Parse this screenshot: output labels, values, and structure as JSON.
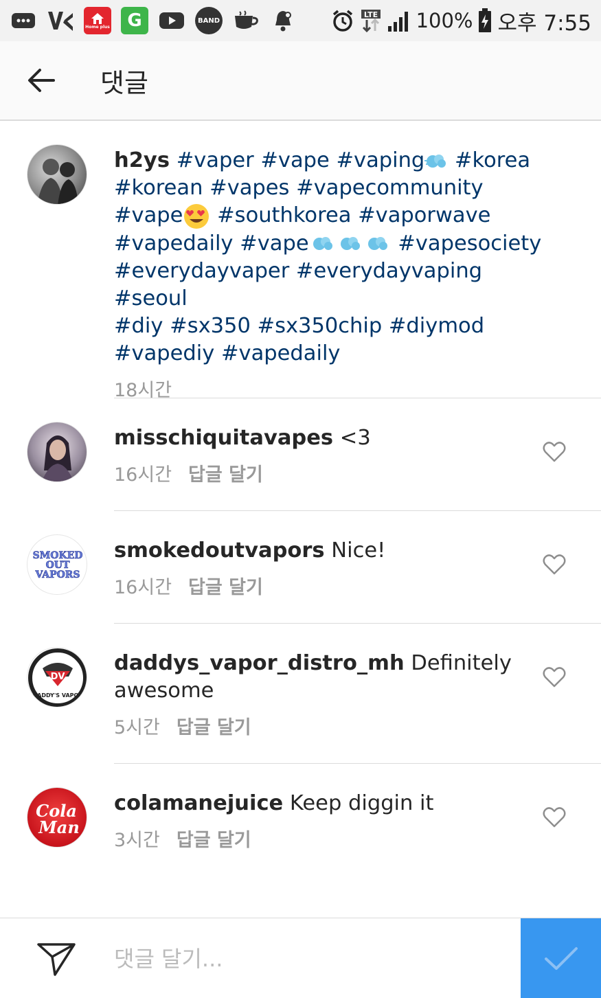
{
  "status_bar": {
    "battery_percent": "100%",
    "time": "오후 7:55",
    "network": "LTE",
    "icons": [
      "message-icon",
      "vs-icon",
      "homeplus-icon",
      "gmarket-icon",
      "youtube-icon",
      "band-icon",
      "cafe-icon",
      "notification-icon",
      "alarm-icon",
      "lte-icon",
      "signal-icon",
      "battery-charging-icon"
    ],
    "homeplus_label": "Home plus",
    "gmarket_label": "G",
    "band_label": "BAND"
  },
  "app_bar": {
    "title": "댓글"
  },
  "caption": {
    "username": "h2ys",
    "tags_line1": "#vaper #vape #vaping",
    "tags_line1b": " #korea",
    "tags_line2": "#korean #vapes #vapecommunity",
    "tags_line3a": "#vape",
    "tags_line3b": " #southkorea #vaporwave",
    "tags_line4a": "#vapedaily #vape",
    "tags_line4b": " #vapesociety",
    "tags_line5": "#everydayvaper #everydayvaping #seoul",
    "tags_line6": "#diy #sx350 #sx350chip #diymod",
    "tags_line7": "#vapediy #vapedaily",
    "time": "18시간"
  },
  "comments": [
    {
      "username": "misschiquitavapes",
      "text": " <3",
      "time": "16시간",
      "reply": "답글 달기"
    },
    {
      "username": "smokedoutvapors",
      "text": " Nice!",
      "time": "16시간",
      "reply": "답글 달기"
    },
    {
      "username": "daddys_vapor_distro_mh",
      "text": " Definitely awesome",
      "time": "5시간",
      "reply": "답글 달기"
    },
    {
      "username": "colamanejuice",
      "text": " Keep diggin it",
      "time": "3시간",
      "reply": "답글 달기"
    }
  ],
  "avatar_labels": {
    "smokedout_line1": "SMOKED",
    "smokedout_line2": "OUT",
    "smokedout_line3": "VAPORS",
    "daddys_badge": "DV",
    "daddys_ring": "DADDY'S VAPOR",
    "colaman_line1": "Cola",
    "colaman_line2": "Man"
  },
  "compose": {
    "placeholder": "댓글 달기..."
  },
  "colors": {
    "accent": "#3897f0",
    "hashtag": "#003569",
    "meta": "#999999"
  }
}
